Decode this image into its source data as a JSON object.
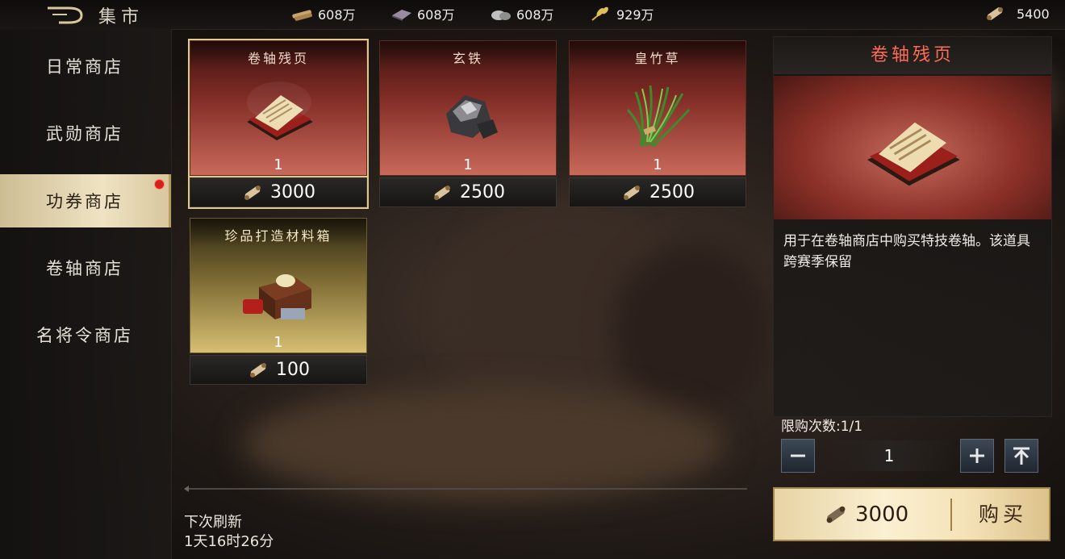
{
  "header": {
    "title": "集市",
    "resources": [
      {
        "icon": "wood-icon",
        "value": "608万"
      },
      {
        "icon": "iron-icon",
        "value": "608万"
      },
      {
        "icon": "stone-icon",
        "value": "608万"
      },
      {
        "icon": "grain-icon",
        "value": "929万"
      }
    ],
    "currency": {
      "icon": "scroll-icon",
      "value": "5400"
    }
  },
  "sidebar": {
    "items": [
      {
        "label": "日常商店",
        "active": false
      },
      {
        "label": "武勋商店",
        "active": false
      },
      {
        "label": "功券商店",
        "active": true,
        "badge": true
      },
      {
        "label": "卷轴商店",
        "active": false
      },
      {
        "label": "名将令商店",
        "active": false
      }
    ]
  },
  "shop": {
    "items": [
      {
        "name": "卷轴残页",
        "qty": "1",
        "price": "3000",
        "icon": "scroll-page-icon",
        "selected": true
      },
      {
        "name": "玄铁",
        "qty": "1",
        "price": "2500",
        "icon": "iron-ore-icon",
        "selected": false
      },
      {
        "name": "皇竹草",
        "qty": "1",
        "price": "2500",
        "icon": "grass-bundle-icon",
        "selected": false
      },
      {
        "name": "珍品打造材料箱",
        "qty": "1",
        "price": "100",
        "icon": "material-chest-icon",
        "selected": false
      }
    ],
    "refresh_label": "下次刷新",
    "refresh_time": "1天16时26分"
  },
  "detail": {
    "title": "卷轴残页",
    "description": "用于在卷轴商店中购买特技卷轴。该道具跨赛季保留",
    "limit": "限购次数:1/1",
    "quantity": "1",
    "buy_price": "3000",
    "buy_label": "购买"
  },
  "colors": {
    "accent_red": "#ff6b57",
    "gold": "#e0c98c"
  }
}
